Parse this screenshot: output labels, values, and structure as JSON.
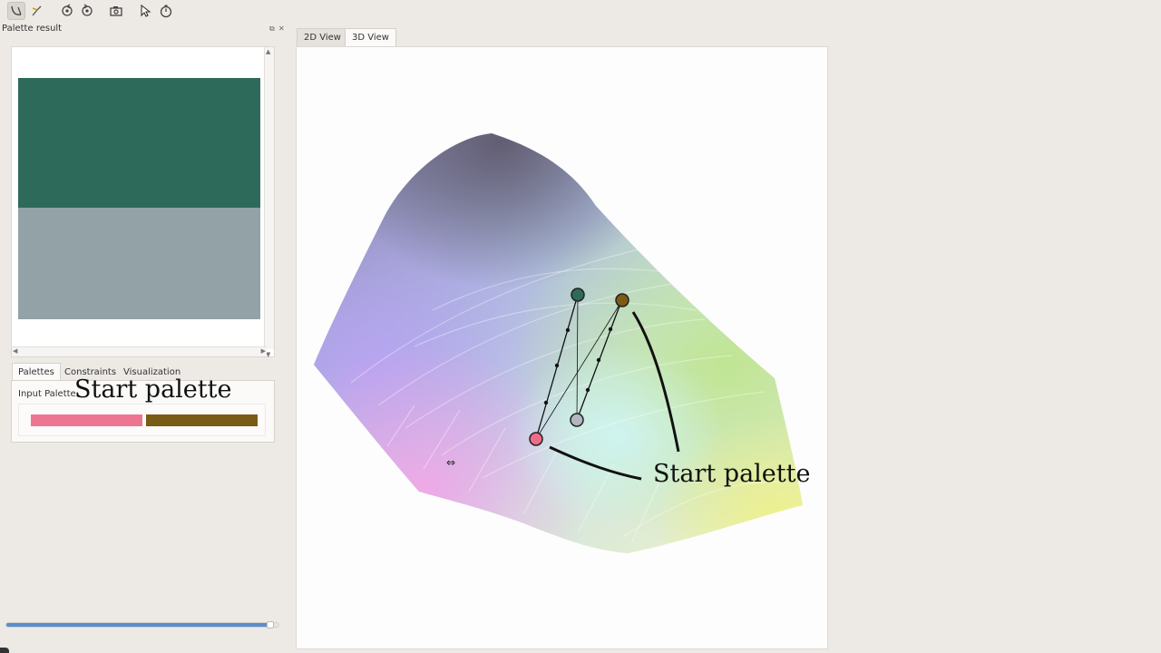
{
  "toolbar": {
    "buttons": [
      {
        "name": "curve-tool",
        "icon": "curve-tool-icon",
        "active": true
      },
      {
        "name": "branch-tool",
        "icon": "branch-tool-icon",
        "active": false
      },
      {
        "name": "rotate-cw",
        "icon": "rotate-cw-icon",
        "active": false
      },
      {
        "name": "rotate-ccw",
        "icon": "rotate-ccw-icon",
        "active": false
      },
      {
        "name": "snapshot",
        "icon": "camera-icon",
        "active": false
      },
      {
        "name": "select",
        "icon": "pointer-icon",
        "active": false
      },
      {
        "name": "timer",
        "icon": "stopwatch-icon",
        "active": false
      }
    ]
  },
  "dock": {
    "title": "Palette result",
    "float_glyph": "⧉",
    "close_glyph": "✕"
  },
  "result_palette": {
    "colors": [
      "#2e6a5a",
      "#92a2a6"
    ]
  },
  "tabs": {
    "palettes": "Palettes",
    "constraints": "Constraints",
    "visualization": "Visualization"
  },
  "input_palette": {
    "label": "Input Palette",
    "annotation": "Start palette",
    "colors": [
      "#ee7592",
      "#7a5b13"
    ]
  },
  "progress": {
    "value": 0.97
  },
  "view_tabs": {
    "view2d": "2D View",
    "view3d": "3D View"
  },
  "view3d": {
    "annotation": "Start palette",
    "point_colors": {
      "pink": "#ee6b8a",
      "brown": "#7e5a12",
      "teal": "#2f6a58",
      "gray": "#b3b6c0"
    }
  }
}
